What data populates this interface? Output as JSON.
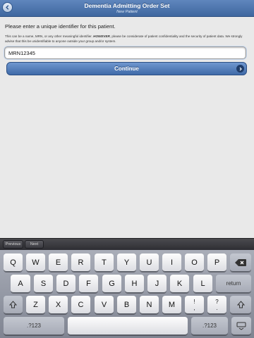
{
  "header": {
    "title": "Dementia Admitting Order Set",
    "subtitle": "New Patient"
  },
  "content": {
    "prompt": "Please enter a unique identifier for this patient.",
    "note_part1": "This can be a name, MRN, or any other meaningful identifier. ",
    "note_emphasis": "HOWEVER",
    "note_part2": ", please be considerate of patient confidentiality and the security of patient data. We strongly advise that this be unidentifiable to anyone outside your group and/or system.",
    "identifier_value": "MRN12345",
    "continue_label": "Continue"
  },
  "toolbar": {
    "previous_label": "Previous",
    "next_label": "Next"
  },
  "keyboard": {
    "row1": [
      "Q",
      "W",
      "E",
      "R",
      "T",
      "Y",
      "U",
      "I",
      "O",
      "P"
    ],
    "row2": [
      "A",
      "S",
      "D",
      "F",
      "G",
      "H",
      "J",
      "K",
      "L"
    ],
    "row3": [
      "Z",
      "X",
      "C",
      "V",
      "B",
      "N",
      "M",
      "!",
      ",",
      "?",
      "."
    ],
    "return_label": "return",
    "numbers_label": ".?123",
    "numbers_label_right": ".?123"
  }
}
